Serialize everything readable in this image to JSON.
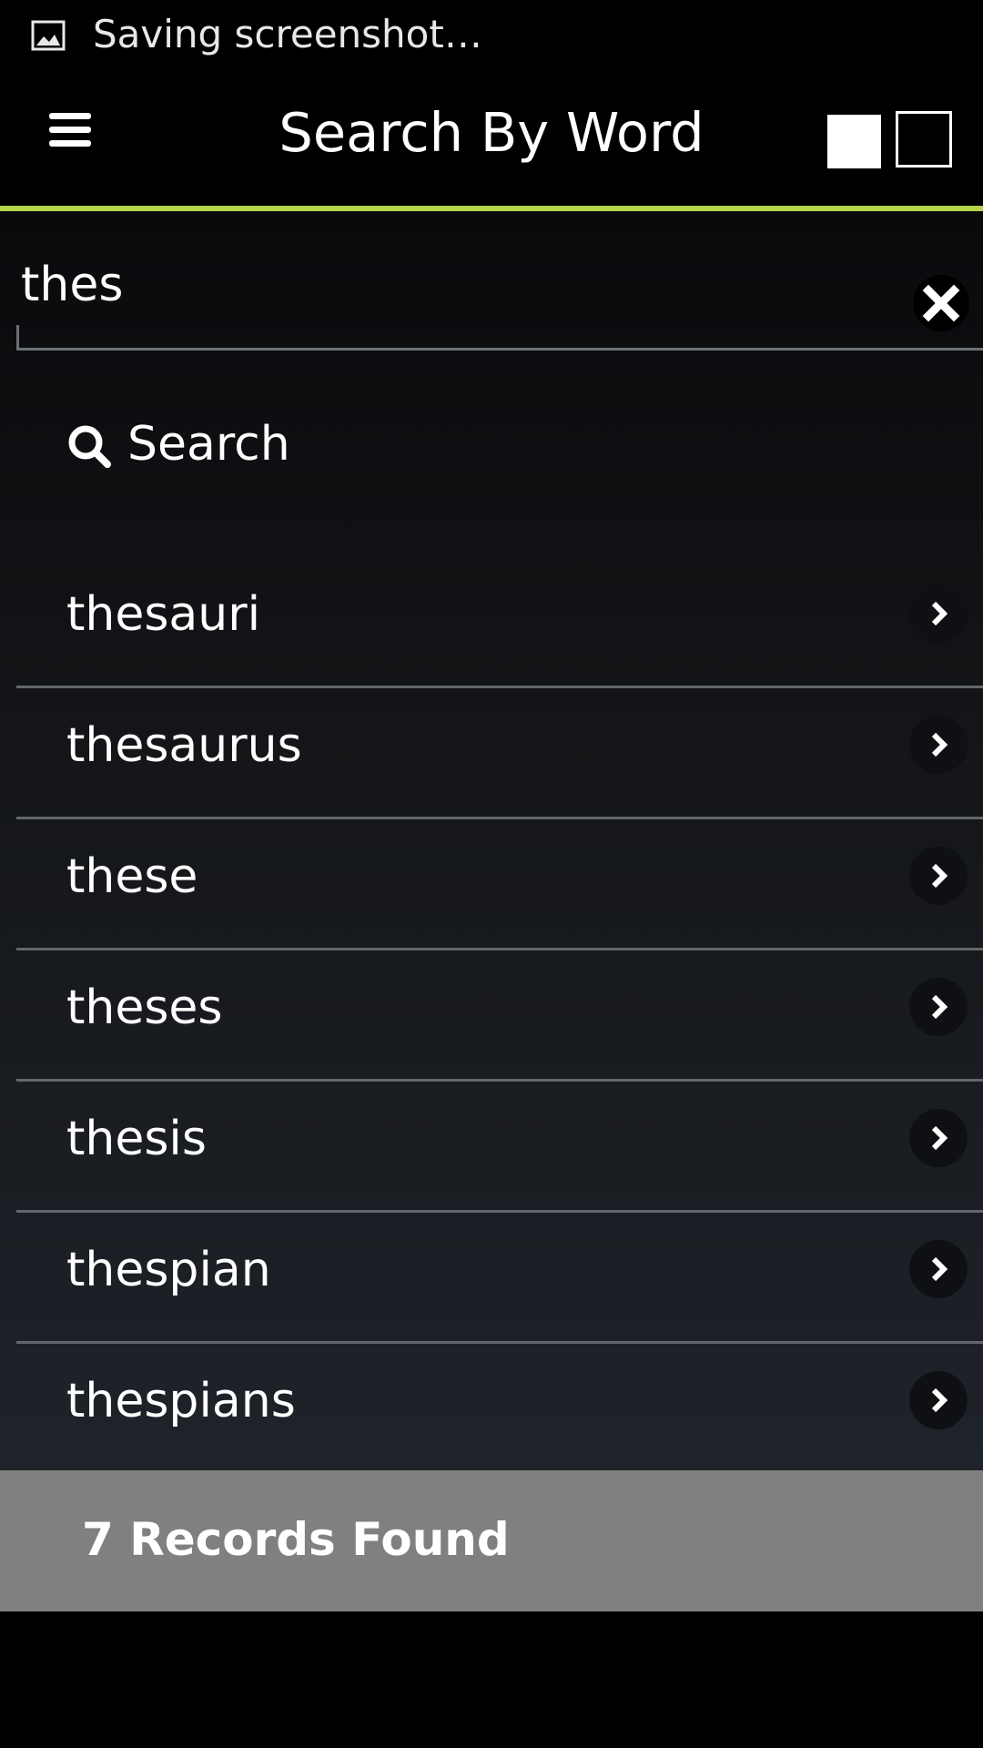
{
  "status_bar": {
    "notification_text": "Saving screenshot…",
    "icon": "image-icon"
  },
  "header": {
    "title": "Search By Word",
    "menu_icon": "hamburger-menu-icon",
    "view_toggle_icons": [
      "filled-square-icon",
      "outline-square-icon"
    ],
    "accent_color": "#b5d34a"
  },
  "search": {
    "value": "thes",
    "placeholder": "",
    "button_label": "Search",
    "clear_icon": "close-x-icon",
    "search_icon": "magnifier-icon"
  },
  "results": [
    {
      "label": "thesauri"
    },
    {
      "label": "thesaurus"
    },
    {
      "label": "these"
    },
    {
      "label": "theses"
    },
    {
      "label": "thesis"
    },
    {
      "label": "thespian"
    },
    {
      "label": "thespians"
    }
  ],
  "result_item_icon": "chevron-right-icon",
  "footer": {
    "records_text": "7 Records Found"
  },
  "colors": {
    "background": "#000000",
    "footer_background": "#808080",
    "divider": "#63666b",
    "text": "#ffffff"
  }
}
